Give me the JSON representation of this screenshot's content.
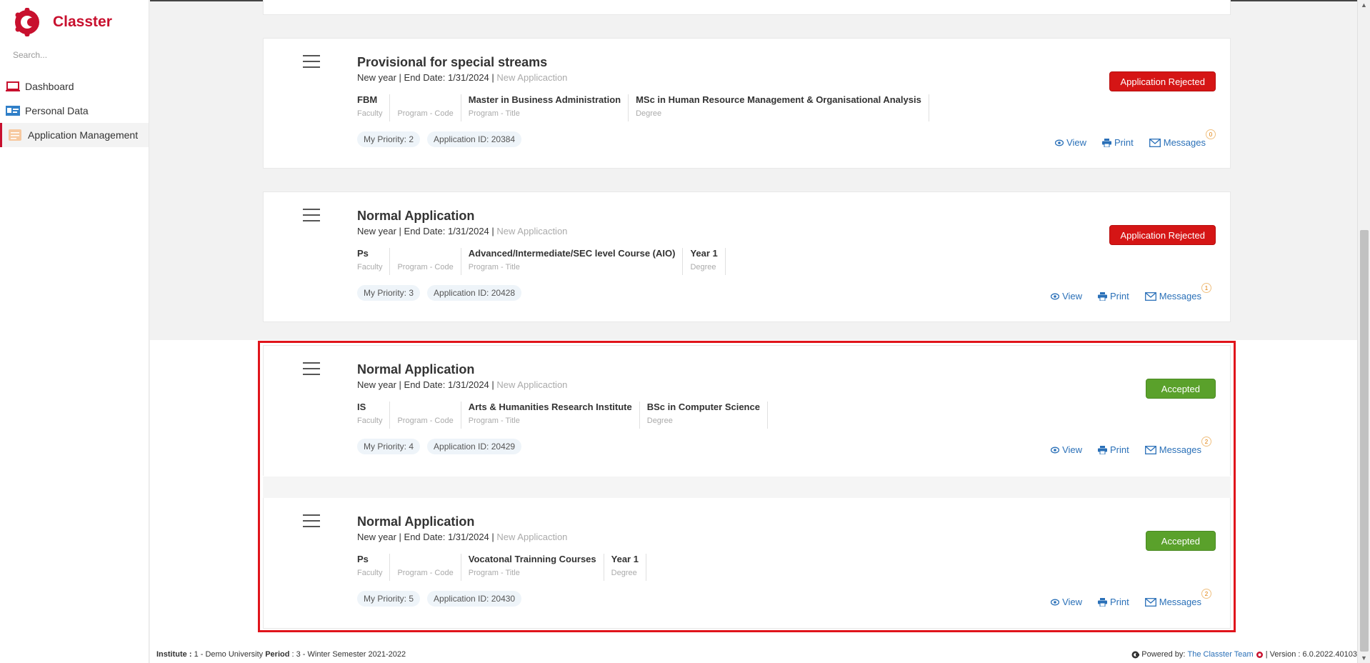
{
  "brand": {
    "name": "Classter"
  },
  "search": {
    "placeholder": "Search..."
  },
  "sidebar": {
    "items": [
      {
        "label": "Dashboard",
        "icon": "laptop-icon",
        "active": false
      },
      {
        "label": "Personal Data",
        "icon": "id-card-icon",
        "active": false
      },
      {
        "label": "Application Management",
        "icon": "application-form-icon",
        "active": true
      }
    ]
  },
  "applications": [
    {
      "title": "Provisional for special streams",
      "year": "New year",
      "end_date": "End Date: 1/31/2024",
      "type": "New Applicaction",
      "fields": [
        {
          "value": "FBM",
          "label": "Faculty"
        },
        {
          "value": "",
          "label": "Program - Code"
        },
        {
          "value": "Master in Business Administration",
          "label": "Program - Title"
        },
        {
          "value": "MSc in Human Resource Management & Organisational Analysis",
          "label": "Degree"
        }
      ],
      "priority": "My Priority: 2",
      "application_id": "Application ID: 20384",
      "status": "Application Rejected",
      "status_color": "#d51515",
      "message_count": "0"
    },
    {
      "title": "Normal Application",
      "year": "New year",
      "end_date": "End Date: 1/31/2024",
      "type": "New Applicaction",
      "fields": [
        {
          "value": "Ps",
          "label": "Faculty"
        },
        {
          "value": "",
          "label": "Program - Code"
        },
        {
          "value": "Advanced/Intermediate/SEC level Course (AIO)",
          "label": "Program - Title"
        },
        {
          "value": "Year 1",
          "label": "Degree"
        }
      ],
      "priority": "My Priority: 3",
      "application_id": "Application ID: 20428",
      "status": "Application Rejected",
      "status_color": "#d51515",
      "message_count": "1"
    },
    {
      "title": "Normal Application",
      "year": "New year",
      "end_date": "End Date: 1/31/2024",
      "type": "New Applicaction",
      "fields": [
        {
          "value": "IS",
          "label": "Faculty"
        },
        {
          "value": "",
          "label": "Program - Code"
        },
        {
          "value": "Arts & Humanities Research Institute",
          "label": "Program - Title"
        },
        {
          "value": "BSc in Computer Science",
          "label": "Degree"
        }
      ],
      "priority": "My Priority: 4",
      "application_id": "Application ID: 20429",
      "status": "Accepted",
      "status_color": "#5aa12b",
      "message_count": "2"
    },
    {
      "title": "Normal Application",
      "year": "New year",
      "end_date": "End Date: 1/31/2024",
      "type": "New Applicaction",
      "fields": [
        {
          "value": "Ps",
          "label": "Faculty"
        },
        {
          "value": "",
          "label": "Program - Code"
        },
        {
          "value": "Vocatonal Trainning Courses",
          "label": "Program - Title"
        },
        {
          "value": "Year 1",
          "label": "Degree"
        }
      ],
      "priority": "My Priority: 5",
      "application_id": "Application ID: 20430",
      "status": "Accepted",
      "status_color": "#5aa12b",
      "message_count": "2"
    }
  ],
  "actions": {
    "view": "View",
    "print": "Print",
    "messages": "Messages"
  },
  "footer": {
    "institute_label": "Institute :",
    "institute_value": "1 - Demo University",
    "period_label": "Period",
    "period_value": ": 3 - Winter Semester 2021-2022",
    "powered_by": "Powered by:",
    "team": "The Classter Team",
    "version": "| Version : 6.0.2022.40103"
  }
}
